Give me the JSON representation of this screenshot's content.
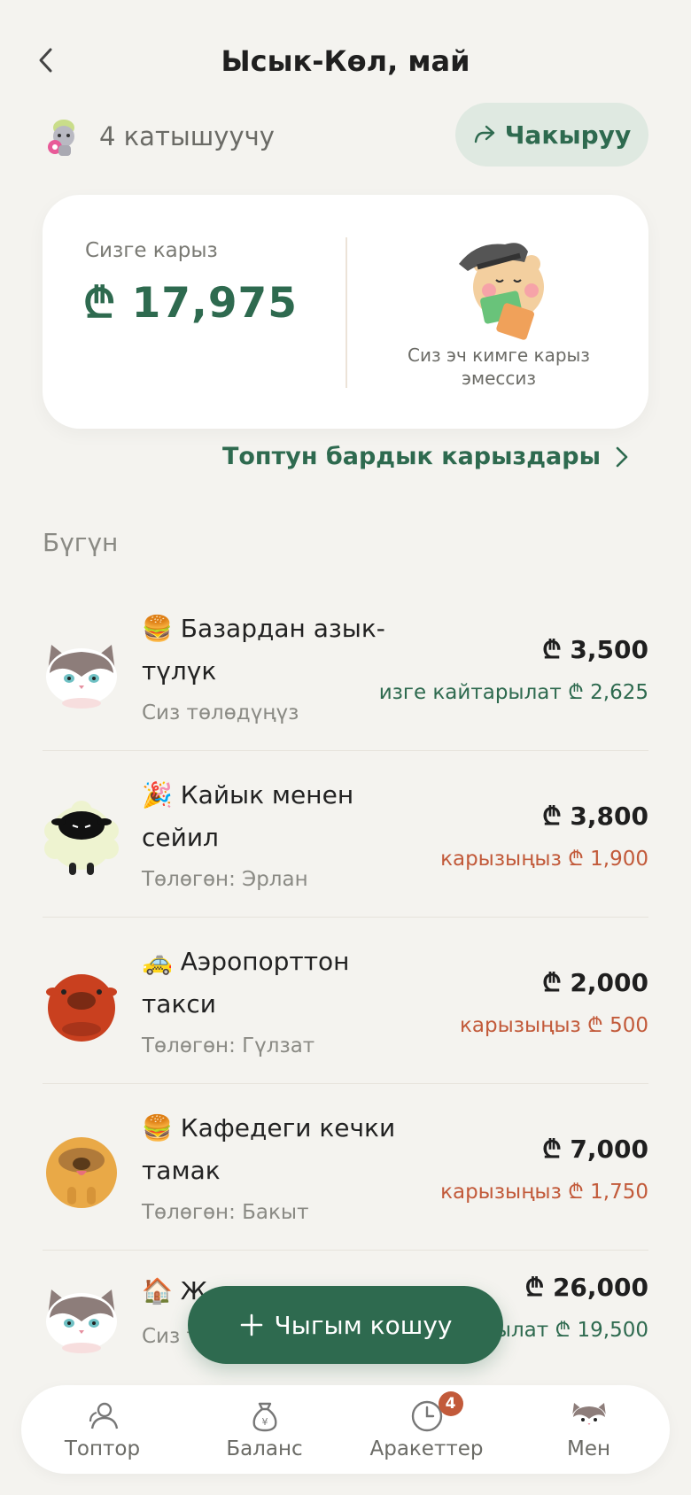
{
  "header": {
    "title": "Ысык-Көл, май",
    "participants_label": "4 катышуучу",
    "invite_label": "Чакыруу"
  },
  "balance": {
    "owed_label": "Сизге карыз",
    "owed_amount": "₾ 17,975",
    "no_debt_text": "Сиз эч кимге карыз эмессиз"
  },
  "all_debts_link": "Топтун бардык карыздары",
  "section_title": "Бүгүн",
  "expenses": [
    {
      "emoji": "🍔",
      "name": "Базардан азык-түлүк",
      "payer": "Сиз төлөдүңүз",
      "total": "₾ 3,500",
      "share": "изге кайтарылат ₾ 2,625",
      "share_type": "green",
      "avatar": "cat"
    },
    {
      "emoji": "🎉",
      "name": "Кайык менен сейил",
      "payer": "Төлөгөн: Эрлан",
      "total": "₾ 3,800",
      "share": "карызыңыз ₾ 1,900",
      "share_type": "red",
      "avatar": "sheep"
    },
    {
      "emoji": "🚕",
      "name": "Аэропорттон такси",
      "payer": "Төлөгөн: Гүлзат",
      "total": "₾ 2,000",
      "share": "карызыңыз ₾ 500",
      "share_type": "red",
      "avatar": "bull"
    },
    {
      "emoji": "🍔",
      "name": "Кафедеги кечки тамак",
      "payer": "Төлөгөн: Бакыт",
      "total": "₾ 7,000",
      "share": "карызыңыз ₾ 1,750",
      "share_type": "red",
      "avatar": "dog"
    },
    {
      "emoji": "🏠",
      "name": "Ж",
      "payer": "Сиз т",
      "total": "₾ 26,000",
      "share": "рылат ₾ 19,500",
      "share_type": "green",
      "avatar": "cat"
    }
  ],
  "add_button_label": "Чыгым кошуу",
  "tabs": [
    {
      "label": "Топтор",
      "icon": "people-icon"
    },
    {
      "label": "Баланс",
      "icon": "money-bag-icon"
    },
    {
      "label": "Аракеттер",
      "icon": "clock-icon",
      "badge": "4"
    },
    {
      "label": "Мен",
      "icon": "cat-avatar-icon"
    }
  ],
  "colors": {
    "accent": "#2e6a4f",
    "debt": "#c25a3a",
    "background": "#f4f3ef"
  }
}
